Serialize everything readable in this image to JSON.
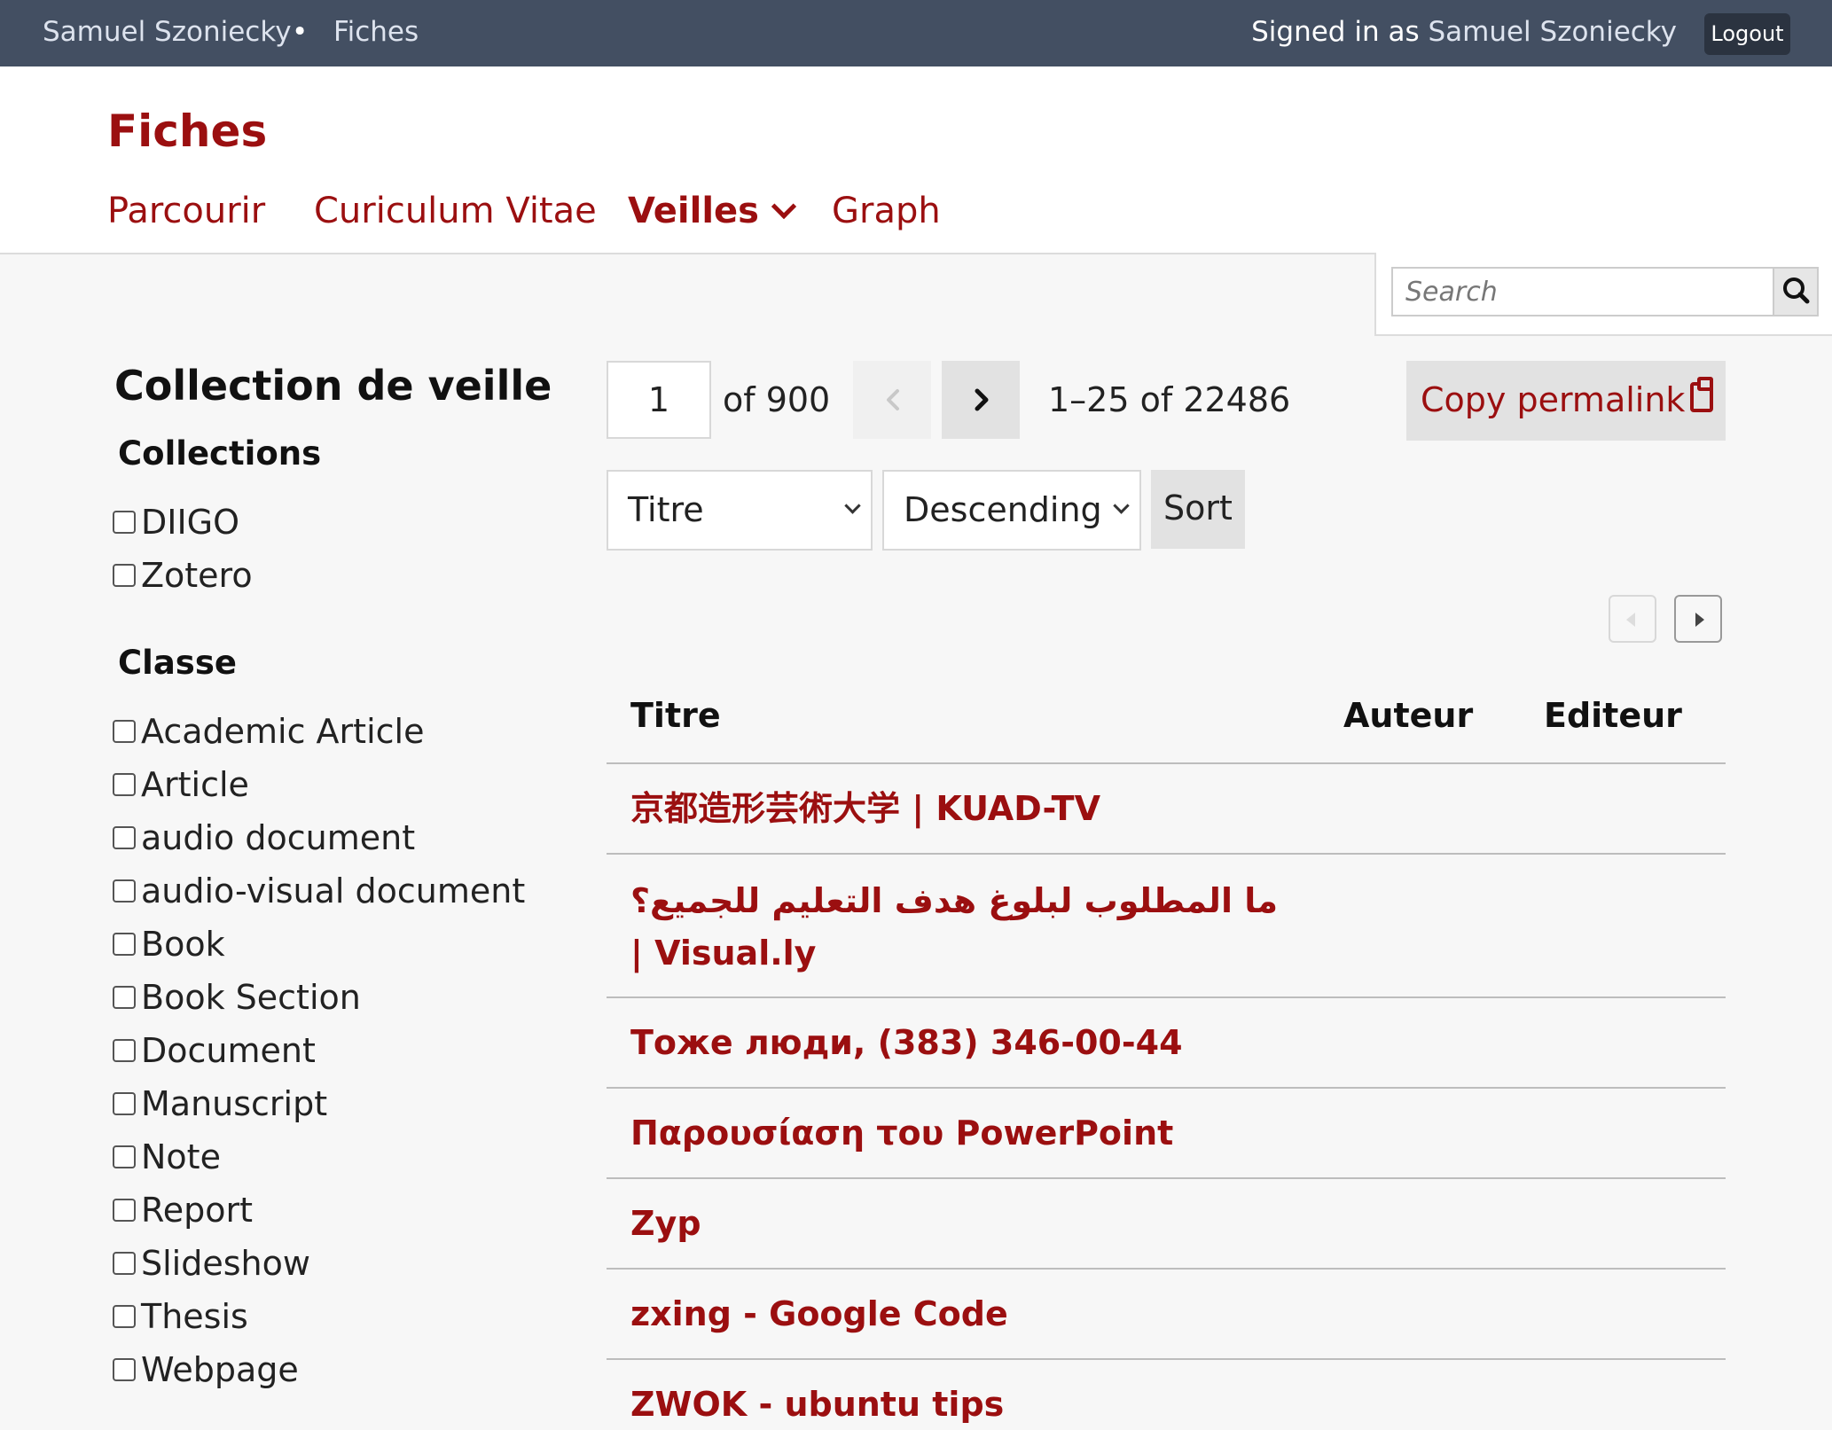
{
  "adminbar": {
    "crumbs": [
      "Samuel Szoniecky",
      "Fiches"
    ],
    "separator": "•",
    "signed_prefix": "Signed in as",
    "signed_user": "Samuel Szoniecky",
    "logout": "Logout"
  },
  "site": {
    "title": "Fiches",
    "nav": [
      "Parcourir",
      "Curiculum Vitae",
      "Veilles",
      "Graph"
    ],
    "active_nav": "Veilles"
  },
  "search": {
    "placeholder": "Search"
  },
  "sidebar": {
    "title": "Collection de veille",
    "collections_heading": "Collections",
    "collections": [
      "DIIGO",
      "Zotero"
    ],
    "classe_heading": "Classe",
    "classes": [
      "Academic Article",
      "Article",
      "audio document",
      "audio-visual document",
      "Book",
      "Book Section",
      "Document",
      "Manuscript",
      "Note",
      "Report",
      "Slideshow",
      "Thesis",
      "Webpage"
    ]
  },
  "pagination": {
    "page": "1",
    "of": "of 900",
    "range": "1–25 of 22486",
    "permalink": "Copy permalink"
  },
  "sorting": {
    "field": "Titre",
    "order": "Descending",
    "button": "Sort"
  },
  "table": {
    "headers": [
      "Titre",
      "Auteur",
      "Editeur"
    ],
    "rows": [
      {
        "title": "京都造形芸術大学 | KUAD-TV"
      },
      {
        "title_line1": "ما المطلوب لبلوغ هدف التعليم للجميع؟",
        "title_line2": "| Visual.ly"
      },
      {
        "title": "Тоже люди, (383) 346-00-44"
      },
      {
        "title": "Παρουσίαση του PowerPoint"
      },
      {
        "title": "Zyp"
      },
      {
        "title": "zxing - Google Code"
      },
      {
        "title": "ZWOK - ubuntu tips"
      }
    ]
  },
  "colors": {
    "accent": "#9b0f10",
    "adminbar": "#434f62"
  }
}
